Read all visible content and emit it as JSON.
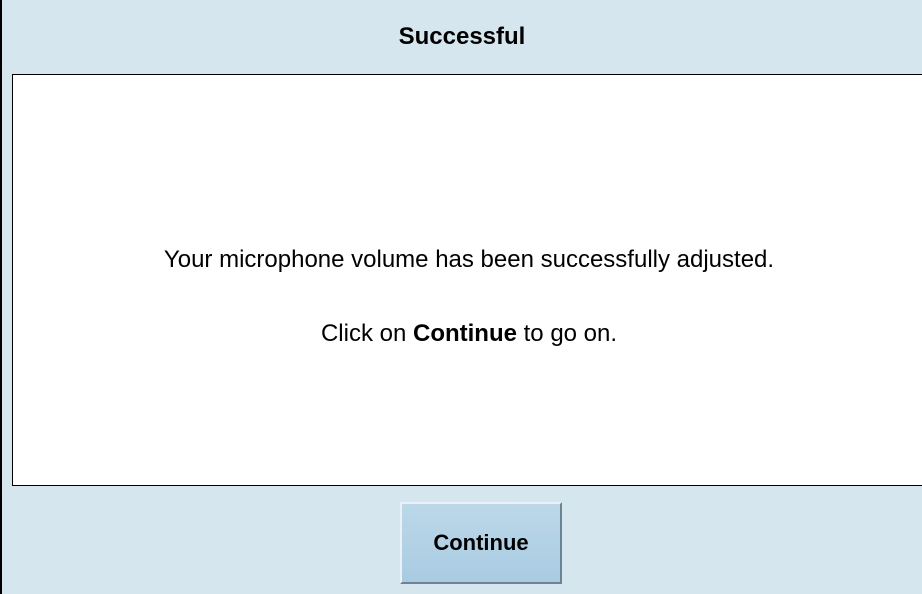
{
  "dialog": {
    "title": "Successful",
    "message": "Your microphone volume has been successfully adjusted.",
    "instruction": {
      "prefix": "Click on ",
      "emphasis": "Continue",
      "suffix": " to go on."
    },
    "continue_label": "Continue"
  },
  "colors": {
    "background": "#d6e6ef",
    "panel": "#ffffff",
    "button": "#a9cbe1",
    "text": "#000000"
  }
}
